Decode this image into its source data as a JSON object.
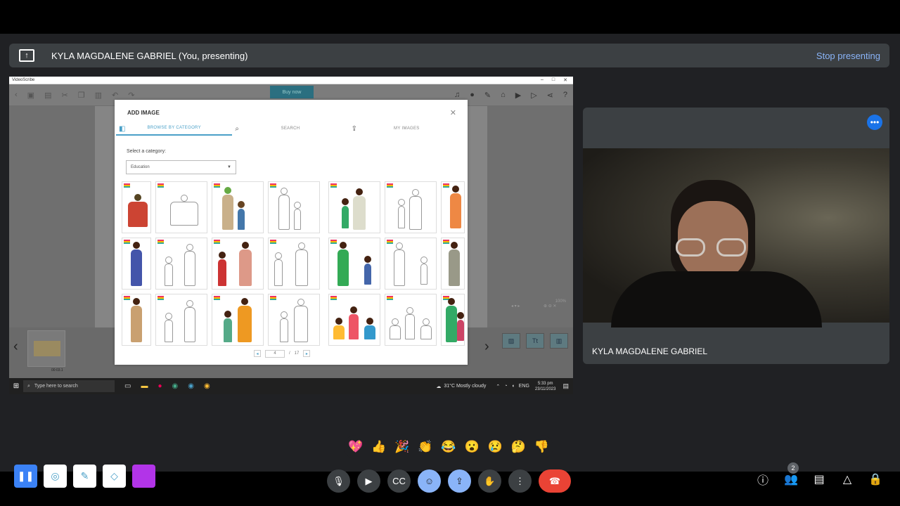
{
  "banner": {
    "presenter": "KYLA MAGDALENE GABRIEL (You, presenting)",
    "stop_label": "Stop presenting"
  },
  "videoscribe": {
    "window_title": "VideoScribe",
    "buy_label": "Buy now",
    "zoom_level": "100%",
    "thumb_time": "00:03.1"
  },
  "dialog": {
    "title": "ADD IMAGE",
    "tabs": [
      "BROWSE BY CATEGORY",
      "SEARCH",
      "MY IMAGES"
    ],
    "category_label": "Select a category:",
    "category_value": "Education",
    "page_current": "4",
    "page_total": "17",
    "page_sep": "/"
  },
  "taskbar": {
    "search_placeholder": "Type here to search",
    "weather": "31°C  Mostly cloudy",
    "lang": "ENG",
    "time": "5:33 pm",
    "date": "23/11/2023"
  },
  "camera": {
    "participant_name": "KYLA MAGDALENE GABRIEL"
  },
  "reactions": [
    "💖",
    "👍",
    "🎉",
    "👏",
    "😂",
    "😮",
    "😢",
    "🤔",
    "👎"
  ],
  "participants_count": "2",
  "colors": {
    "accent": "#8ab4f8",
    "end_call": "#ea4335",
    "meet_bg": "#202124",
    "videoscribe_accent": "#4aa0c8",
    "pen_color": "#b234e8"
  }
}
